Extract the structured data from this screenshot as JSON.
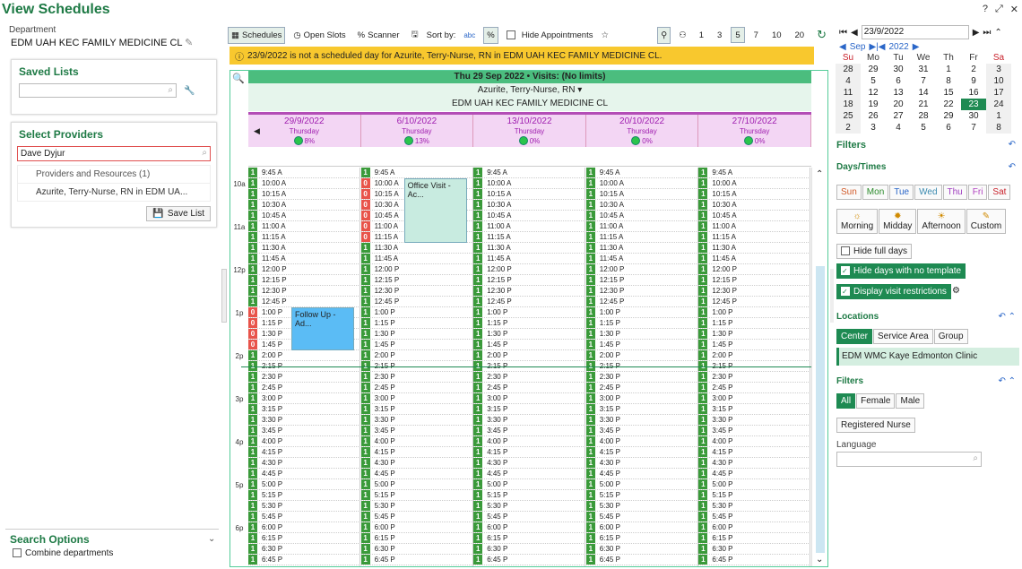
{
  "page_title": "View Schedules",
  "department": {
    "label": "Department",
    "value": "EDM UAH KEC FAMILY MEDICINE CL"
  },
  "saved_lists": {
    "title": "Saved Lists"
  },
  "select_providers": {
    "title": "Select Providers",
    "search_value": "Dave Dyjur",
    "items": [
      "Providers and Resources (1)",
      "Azurite, Terry-Nurse, RN in EDM UA..."
    ],
    "save_label": "Save List"
  },
  "search_options": {
    "title": "Search Options",
    "combine_label": "Combine departments"
  },
  "toolbar": {
    "schedules": "Schedules",
    "open_slots": "Open Slots",
    "scanner": "Scanner",
    "sort_by": "Sort by:",
    "hide_appts": "Hide Appointments",
    "nums": [
      "1",
      "3",
      "5",
      "7",
      "10",
      "20"
    ],
    "selected_num": "5"
  },
  "warning": "23/9/2022 is not a scheduled day for Azurite, Terry-Nurse, RN in EDM UAH KEC FAMILY MEDICINE CL.",
  "grid": {
    "header": "Thu 29 Sep 2022 • Visits: (No limits)",
    "provider": "Azurite, Terry-Nurse, RN ▾",
    "dept": "EDM UAH KEC FAMILY MEDICINE CL",
    "days": [
      {
        "date": "29/9/2022",
        "dow": "Thursday",
        "pct": "8%"
      },
      {
        "date": "6/10/2022",
        "dow": "Thursday",
        "pct": "13%"
      },
      {
        "date": "13/10/2022",
        "dow": "Thursday",
        "pct": "0%"
      },
      {
        "date": "20/10/2022",
        "dow": "Thursday",
        "pct": "0%"
      },
      {
        "date": "27/10/2022",
        "dow": "Thursday",
        "pct": "0%"
      }
    ],
    "times": [
      "9:45 A",
      "10:00 A",
      "10:15 A",
      "10:30 A",
      "10:45 A",
      "11:00 A",
      "11:15 A",
      "11:30 A",
      "11:45 A",
      "12:00 P",
      "12:15 P",
      "12:30 P",
      "12:45 P",
      "1:00 P",
      "1:15 P",
      "1:30 P",
      "1:45 P",
      "2:00 P",
      "2:15 P",
      "2:30 P",
      "2:45 P",
      "3:00 P",
      "3:15 P",
      "3:30 P",
      "3:45 P",
      "4:00 P",
      "4:15 P",
      "4:30 P",
      "4:45 P",
      "5:00 P",
      "5:15 P",
      "5:30 P",
      "5:45 P",
      "6:00 P",
      "6:15 P",
      "6:30 P",
      "6:45 P"
    ],
    "hours": [
      {
        "label": "10a",
        "slot": 1
      },
      {
        "label": "11a",
        "slot": 5
      },
      {
        "label": "12p",
        "slot": 9
      },
      {
        "label": "1p",
        "slot": 13
      },
      {
        "label": "2p",
        "slot": 17
      },
      {
        "label": "3p",
        "slot": 21
      },
      {
        "label": "4p",
        "slot": 25
      },
      {
        "label": "5p",
        "slot": 29
      },
      {
        "label": "6p",
        "slot": 33
      }
    ],
    "appointments": [
      {
        "col": 0,
        "start": 13,
        "len": 4,
        "label": "Follow Up - Ad...",
        "color": "#5bbcf5"
      },
      {
        "col": 1,
        "start": 1,
        "len": 6,
        "label": "Office Visit - Ac...",
        "color": "#c8ebe0"
      }
    ],
    "red": [
      [
        0,
        13
      ],
      [
        0,
        14
      ],
      [
        0,
        15
      ],
      [
        0,
        16
      ],
      [
        1,
        1
      ],
      [
        1,
        2
      ],
      [
        1,
        3
      ],
      [
        1,
        4
      ],
      [
        1,
        5
      ],
      [
        1,
        6
      ]
    ]
  },
  "calendar": {
    "date_value": "23/9/2022",
    "month": "Sep",
    "year": "2022",
    "dows": [
      "Su",
      "Mo",
      "Tu",
      "We",
      "Th",
      "Fr",
      "Sa"
    ],
    "weeks": [
      [
        "28",
        "29",
        "30",
        "31",
        "1",
        "2",
        "3"
      ],
      [
        "4",
        "5",
        "6",
        "7",
        "8",
        "9",
        "10"
      ],
      [
        "11",
        "12",
        "13",
        "14",
        "15",
        "16",
        "17"
      ],
      [
        "18",
        "19",
        "20",
        "21",
        "22",
        "23",
        "24"
      ],
      [
        "25",
        "26",
        "27",
        "28",
        "29",
        "30",
        "1"
      ],
      [
        "2",
        "3",
        "4",
        "5",
        "6",
        "7",
        "8"
      ]
    ],
    "selected": "23"
  },
  "filters": {
    "title": "Filters",
    "days_times": "Days/Times",
    "days": [
      "Sun",
      "Mon",
      "Tue",
      "Wed",
      "Thu",
      "Fri",
      "Sat"
    ],
    "day_colors": [
      "#d25a28",
      "#2a8a2a",
      "#2a66c8",
      "#3a8ab0",
      "#a040c0",
      "#b040c0",
      "#c8202a"
    ],
    "periods": [
      "Morning",
      "Midday",
      "Afternoon",
      "Custom"
    ],
    "hide_full": "Hide full days",
    "hide_no_template": "Hide days with no template",
    "display_restrictions": "Display visit restrictions",
    "locations": "Locations",
    "loc_tabs": [
      "Center",
      "Service Area",
      "Group"
    ],
    "loc_value": "EDM WMC Kaye Edmonton Clinic",
    "filters2": "Filters",
    "sex": [
      "All",
      "Female",
      "Male"
    ],
    "role": "Registered Nurse",
    "language": "Language"
  }
}
